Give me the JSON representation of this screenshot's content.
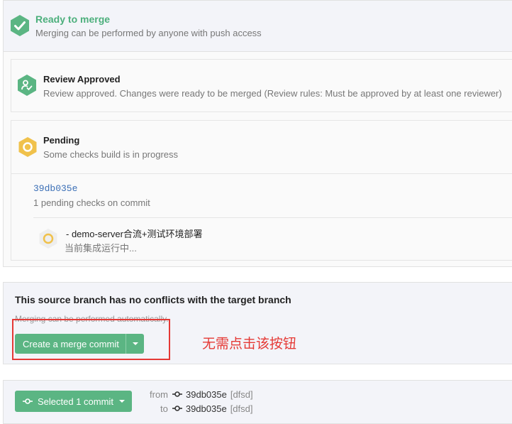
{
  "ready": {
    "title": "Ready to merge",
    "subtitle": "Merging can be performed by anyone with push access"
  },
  "review": {
    "title": "Review Approved",
    "subtitle": "Review approved. Changes were ready to be merged (Review rules: Must be approved by at least one reviewer)"
  },
  "pending": {
    "title": "Pending",
    "subtitle": "Some checks build is in progress",
    "commit_sha": "39db035e",
    "commit_status": "1 pending checks on commit",
    "job_name": "- demo-server合流+测试环境部署",
    "job_status": "当前集成运行中..."
  },
  "no_conflicts": {
    "title": "This source branch has no conflicts with the target branch",
    "subtitle": "Merging can be performed automatically.",
    "merge_button": "Create a merge commit",
    "annotation": "无需点击该按钮"
  },
  "selection": {
    "button_label": "Selected 1 commit",
    "from_label": "from",
    "from_sha": "39db035e",
    "from_branch": "[dfsd]",
    "to_label": "to",
    "to_sha": "39db035e",
    "to_branch": "[dfsd]"
  },
  "colors": {
    "success": "#5bb583",
    "pending": "#f0c14b",
    "annotation": "#e53935",
    "link": "#3b6fb6"
  },
  "icons": {
    "ready": "check-circle-icon",
    "review": "review-approved-icon",
    "pending": "pending-hexagon-icon",
    "job": "job-pending-icon",
    "commit": "commit-icon",
    "dropdown": "caret-down-icon"
  }
}
